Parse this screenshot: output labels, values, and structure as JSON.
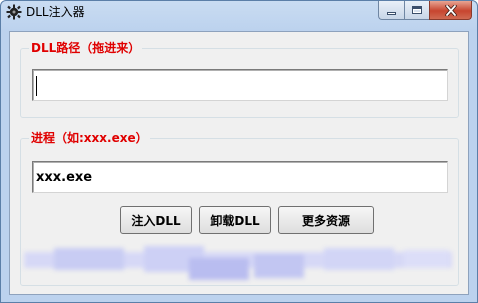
{
  "window": {
    "title": "DLL注入器",
    "icon": "gear-bug-icon"
  },
  "caption_buttons": {
    "minimize_icon": "minimize-icon",
    "maximize_icon": "maximize-icon",
    "close_icon": "close-icon"
  },
  "dll_group": {
    "label": "DLL路径（拖进来）",
    "path_value": ""
  },
  "process_group": {
    "label": "进程（如:xxx.exe）",
    "process_value": "xxx.exe"
  },
  "buttons": {
    "inject_label": "注入DLL",
    "uninject_label": "卸载DLL",
    "more_label": "更多资源"
  },
  "colors": {
    "group_label": "#e00000",
    "blurred_strip": "#cfd2f4"
  }
}
